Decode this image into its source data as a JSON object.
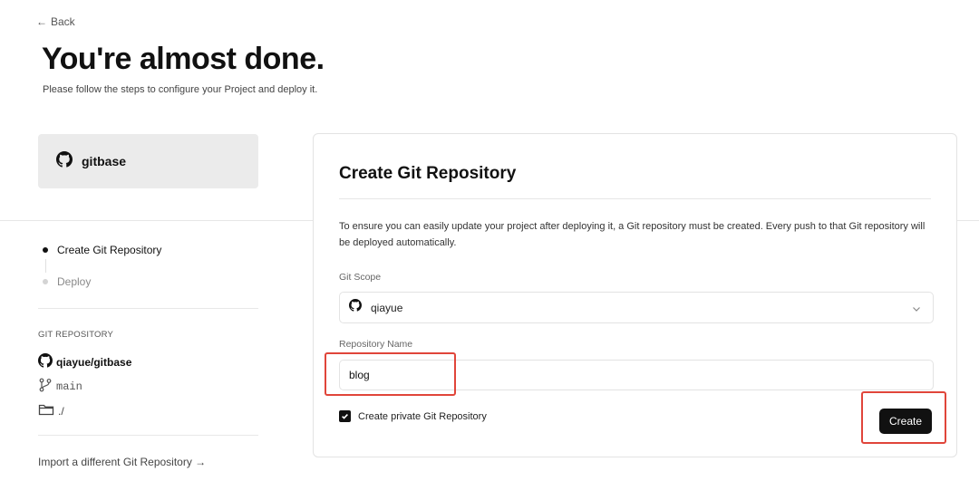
{
  "nav": {
    "back_arrow": "←",
    "back_label": "Back"
  },
  "header": {
    "title": "You're almost done.",
    "subtitle": "Please follow the steps to configure your Project and deploy it."
  },
  "repo_card": {
    "icon": "github-icon",
    "name": "gitbase"
  },
  "steps": [
    {
      "label": "Create Git Repository",
      "state": "active"
    },
    {
      "label": "Deploy",
      "state": "inactive"
    }
  ],
  "git_repository": {
    "heading": "GIT REPOSITORY",
    "repo": "qiayue/gitbase",
    "branch": "main",
    "directory": "./"
  },
  "import_link": "Import a different Git Repository →",
  "form": {
    "title": "Create Git Repository",
    "description": "To ensure you can easily update your project after deploying it, a Git repository must be created. Every push to that Git repository will be deployed automatically.",
    "scope_label": "Git Scope",
    "scope_value": "qiayue",
    "name_label": "Repository Name",
    "name_value": "blog",
    "private_label": "Create private Git Repository",
    "private_checked": true,
    "create_label": "Create"
  },
  "colors": {
    "accent": "#111111",
    "highlight": "#e0453a",
    "card_bg": "#ebebeb",
    "border": "#e3e3e3"
  }
}
